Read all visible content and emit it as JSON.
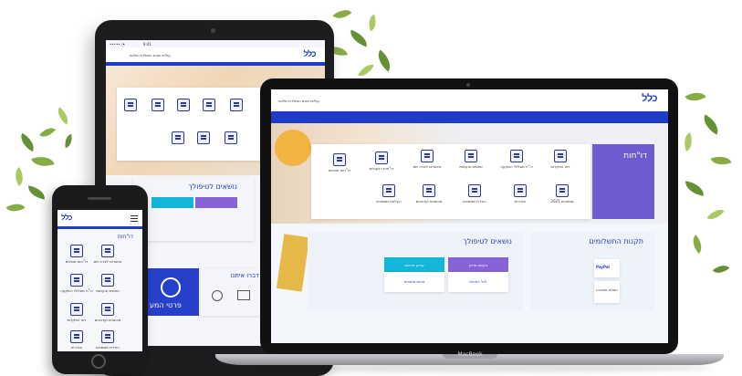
{
  "colors": {
    "brand_blue": "#1f3cc7",
    "nav_purple": "#6d5bd0",
    "purple_button": "#8663d6",
    "cyan_button": "#13b6d8",
    "background": "#ffffff"
  },
  "tablet": {
    "header_tagline": "עולים שהם המולדת שלכם",
    "logo": "כלל",
    "section_topics": "נושאים לטיפולך",
    "side_label": "ים",
    "banner_text": "פרטי המע",
    "contact_title": "דברו איתנו"
  },
  "laptop": {
    "header_tagline": "עולים שהם המולדת שלכם",
    "logo": "כלל",
    "reports_title": "דו\"חות",
    "report_items": [
      {
        "icon": "report-icon",
        "label": "דו\"חות שנתיים"
      },
      {
        "icon": "chart-icon",
        "label": "דו\"חות רבעוניים"
      },
      {
        "icon": "document-icon",
        "label": "אישורים לצרכי מס"
      },
      {
        "icon": "form-icon",
        "label": "טפסים ובקשות"
      },
      {
        "icon": "file-icon",
        "label": "דו\"ח מסלולי השקעה"
      },
      {
        "icon": "money-icon",
        "label": "דוח הפקדות"
      },
      {
        "icon": "building-icon",
        "label": "מסמכים 2021"
      },
      {
        "icon": "settings-icon",
        "label": "הגדרות"
      },
      {
        "icon": "download-icon",
        "label": "הורדת מסמכים"
      },
      {
        "icon": "mail-icon",
        "label": "מכתבים ועדכונים"
      },
      {
        "icon": "upload-icon",
        "label": "העלאת מסמכים"
      }
    ],
    "topics_title": "נושאים לטיפולך",
    "topic_buttons": [
      "עדכון פרטים",
      "בקשת מידע"
    ],
    "topic_links": [
      "לכל הפניות",
      "פניות פתוחות"
    ],
    "payments_title": "תקנות התשלומים",
    "payment_logo": "PayPal",
    "payment_text": "תשלום מאובטח"
  },
  "phone": {
    "logo": "כלל",
    "title": "דו\"חות",
    "items": [
      "דו\"חות שנתיים",
      "אישורים לצרכי מס",
      "דו\"ח מסלולי השקעה",
      "טפסים ובקשות",
      "דוח הפקדות",
      "מכתבים ועדכונים",
      "הגדרות",
      "הורדת מסמכים"
    ]
  },
  "device_label": "MacBook"
}
